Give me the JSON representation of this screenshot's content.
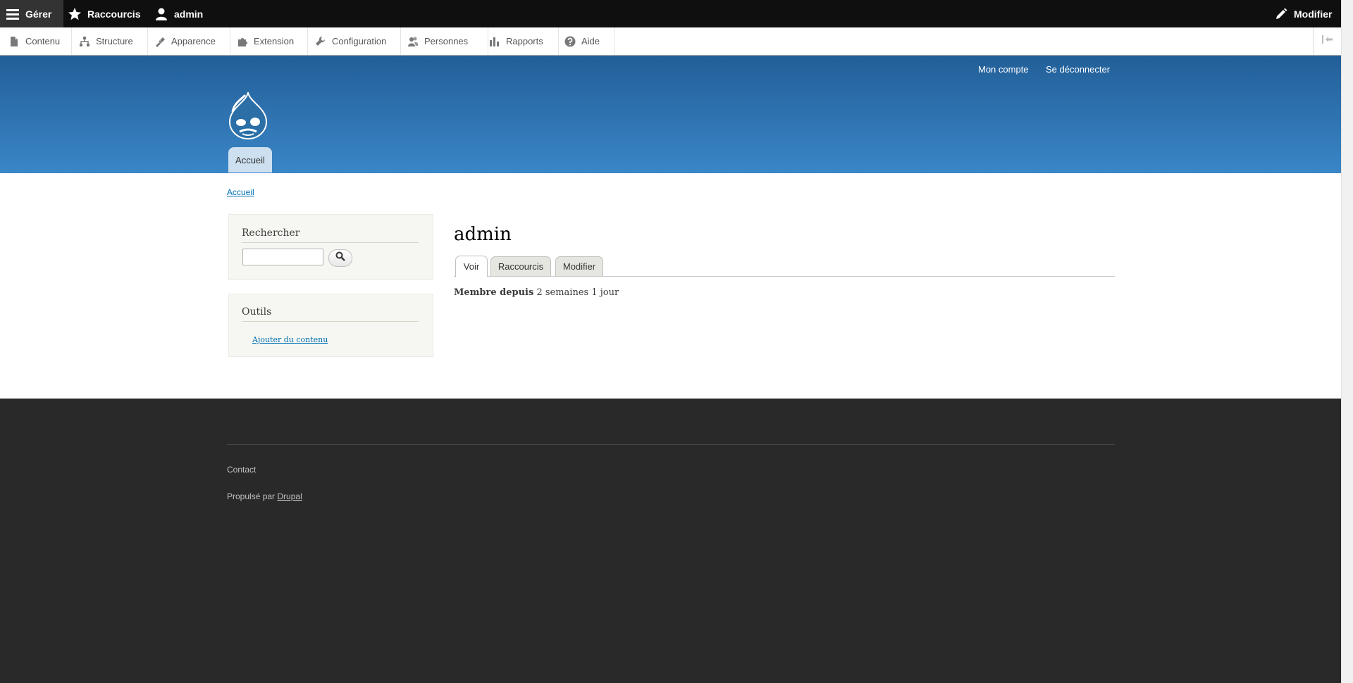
{
  "toolbar": {
    "manage_label": "Gérer",
    "shortcuts_label": "Raccourcis",
    "user_label": "admin",
    "edit_label": "Modifier"
  },
  "tray": {
    "items": [
      {
        "label": "Contenu",
        "icon": "file-icon"
      },
      {
        "label": "Structure",
        "icon": "sitemap-icon"
      },
      {
        "label": "Apparence",
        "icon": "paint-brush-icon"
      },
      {
        "label": "Extension",
        "icon": "puzzle-icon"
      },
      {
        "label": "Configuration",
        "icon": "wrench-icon"
      },
      {
        "label": "Personnes",
        "icon": "people-icon"
      },
      {
        "label": "Rapports",
        "icon": "bar-chart-icon"
      },
      {
        "label": "Aide",
        "icon": "help-icon"
      }
    ]
  },
  "header": {
    "my_account": "Mon compte",
    "logout": "Se déconnecter",
    "home_tab": "Accueil"
  },
  "breadcrumb": "Accueil",
  "sidebar": {
    "search_title": "Rechercher",
    "search_placeholder": "",
    "tools_title": "Outils",
    "add_content": "Ajouter du contenu"
  },
  "main": {
    "title": "admin",
    "tabs": [
      "Voir",
      "Raccourcis",
      "Modifier"
    ],
    "member_label": "Membre depuis",
    "member_value": "2 semaines 1 jour"
  },
  "footer": {
    "contact": "Contact",
    "powered_by": "Propulsé par",
    "drupal": "Drupal"
  },
  "colors": {
    "header_top": "#225f98",
    "header_bottom": "#3a86c7",
    "toolbar": "#0f0f0f",
    "footer": "#292929",
    "link": "#0071b3"
  }
}
